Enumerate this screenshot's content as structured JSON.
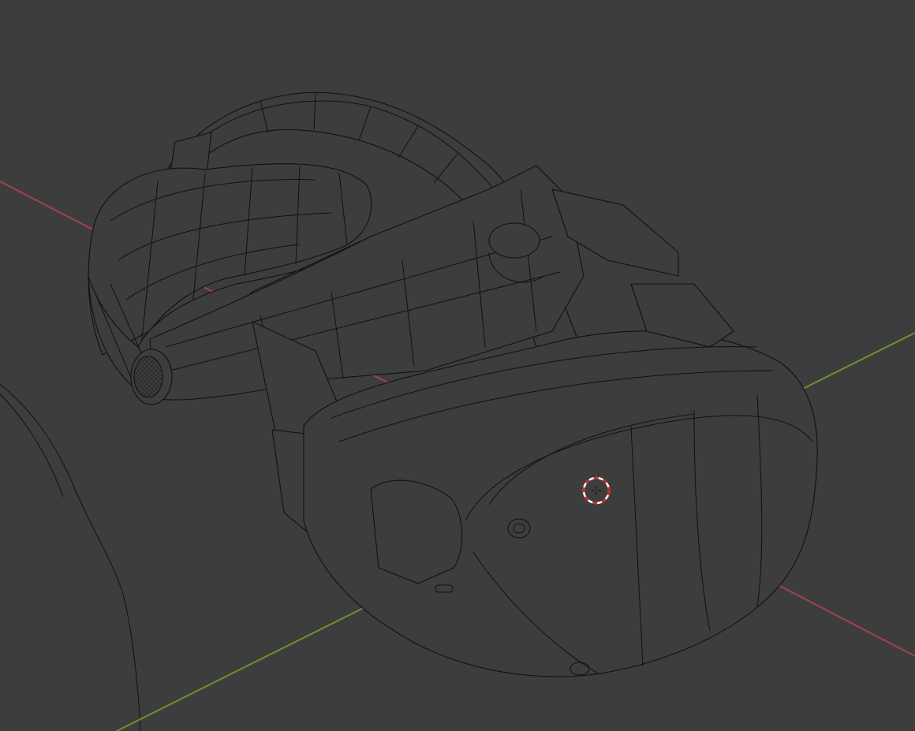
{
  "viewport": {
    "mode": "wireframe",
    "background_color": "#3d3d3d",
    "wire_color": "#111111",
    "axes": {
      "x_axis_color": "#a4434c",
      "y_axis_color": "#6b9130"
    },
    "object": "vr-headset",
    "cursor": {
      "icon": "3d-cursor-icon",
      "ring_colors": [
        "#ffffff",
        "#d22828"
      ]
    }
  }
}
